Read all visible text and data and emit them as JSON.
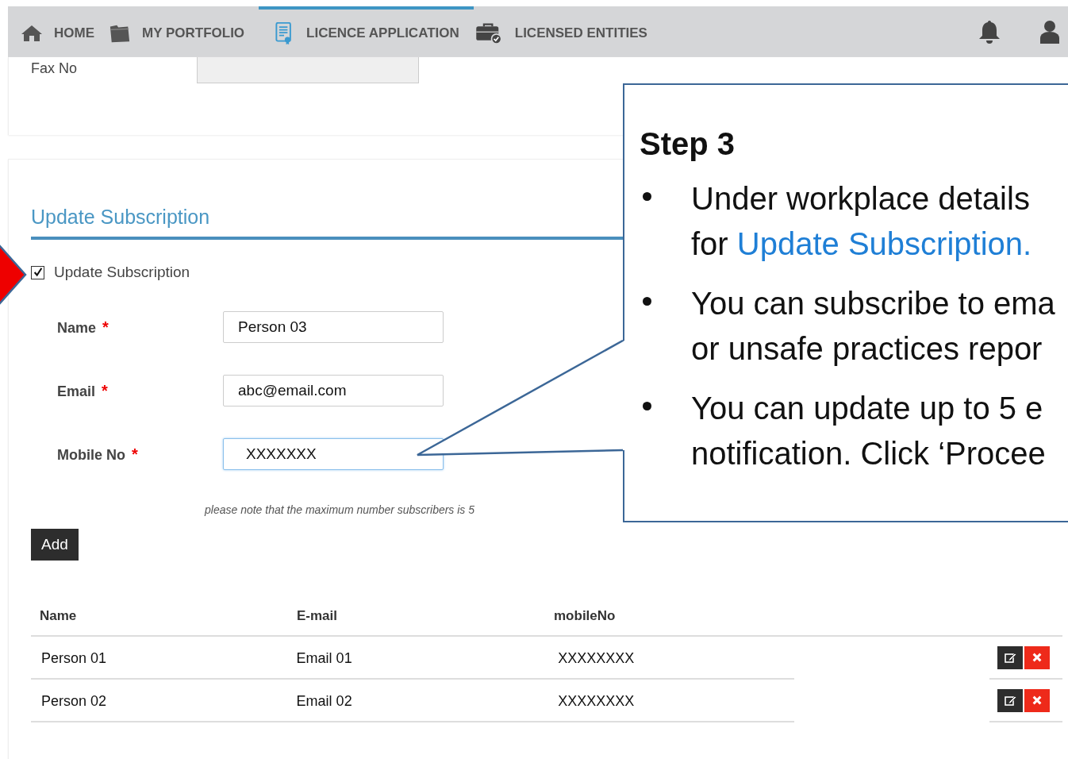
{
  "nav": {
    "items": [
      {
        "label": "HOME",
        "kind": "home",
        "selected": false
      },
      {
        "label": "MY PORTFOLIO",
        "kind": "folder",
        "selected": false
      },
      {
        "label": "LICENCE APPLICATION",
        "kind": "document",
        "selected": true
      },
      {
        "label": "LICENSED ENTITIES",
        "kind": "briefcase",
        "selected": false
      }
    ]
  },
  "fax": {
    "label": "Fax No"
  },
  "section": {
    "title": "Update Subscription",
    "checkbox": {
      "label": "Update Subscription",
      "checked": true
    },
    "fields": [
      {
        "label": "Name",
        "required_mark": "*",
        "value": "Person 03",
        "focused": false
      },
      {
        "label": "Email",
        "required_mark": "*",
        "value": "abc@email.com",
        "focused": false
      },
      {
        "label": "Mobile No",
        "required_mark": "*",
        "value": "XXXXXXX",
        "focused": true
      }
    ],
    "note": "please note that the maximum number subscribers is 5",
    "add_button": "Add",
    "table": {
      "columns": [
        "Name",
        "E-mail",
        "mobileNo"
      ],
      "rows": [
        {
          "cells": [
            "Person 01",
            "Email 01",
            "XXXXXXXX"
          ]
        },
        {
          "cells": [
            "Person 02",
            "Email 02",
            "XXXXXXXX"
          ]
        }
      ]
    }
  },
  "callout": {
    "title": "Step 3",
    "bullets": [
      {
        "lines": [
          {
            "text": "Under workplace details"
          },
          {
            "text": "for ",
            "highlight": "Update Subscription."
          }
        ]
      },
      {
        "lines": [
          {
            "text": "You can subscribe to ema"
          },
          {
            "text": "or unsafe practices repor"
          }
        ]
      },
      {
        "lines": [
          {
            "text": "You can update up to 5 e"
          },
          {
            "text": "notification. Click ‘Procee"
          }
        ]
      }
    ]
  }
}
